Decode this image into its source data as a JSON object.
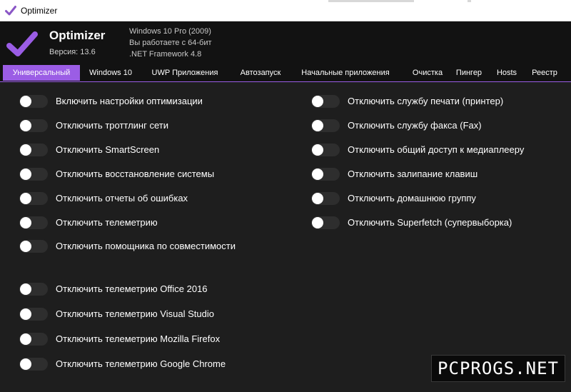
{
  "window": {
    "title": "Optimizer"
  },
  "header": {
    "app_name": "Optimizer",
    "version": "Версия: 13.6",
    "sysinfo": [
      "Windows 10 Pro (2009)",
      "Вы работаете с 64-бит",
      ".NET Framework 4.8"
    ]
  },
  "tabs": [
    {
      "label": "Универсальный",
      "active": true
    },
    {
      "label": "Windows 10",
      "active": false
    },
    {
      "label": "UWP Приложения",
      "active": false
    },
    {
      "label": "Автозапуск",
      "active": false
    },
    {
      "label": "Начальные приложения",
      "active": false
    },
    {
      "label": "Очистка",
      "active": false
    },
    {
      "label": "Пингер",
      "active": false
    },
    {
      "label": "Hosts",
      "active": false
    },
    {
      "label": "Реестр",
      "active": false
    }
  ],
  "left_options": [
    {
      "label": "Включить настройки оптимизации",
      "on": false
    },
    {
      "label": "Отключить троттлинг сети",
      "on": false
    },
    {
      "label": "Отключить SmartScreen",
      "on": false
    },
    {
      "label": "Отключить восстановление системы",
      "on": false
    },
    {
      "label": "Отключить отчеты об ошибках",
      "on": false
    },
    {
      "label": "Отключить телеметрию",
      "on": false
    },
    {
      "label": "Отключить помощника по совместимости",
      "on": false
    }
  ],
  "right_options": [
    {
      "label": "Отключить службу печати (принтер)",
      "on": false
    },
    {
      "label": "Отключить службу факса (Fax)",
      "on": false
    },
    {
      "label": "Отключить общий доступ к медиаплееру",
      "on": false
    },
    {
      "label": "Отключить залипание клавиш",
      "on": false
    },
    {
      "label": "Отключить домашнюю группу",
      "on": false
    },
    {
      "label": "Отключить Superfetch (супервыборка)",
      "on": false
    }
  ],
  "telemetry_options": [
    {
      "label": "Отключить телеметрию Office 2016",
      "on": false
    },
    {
      "label": "Отключить телеметрию Visual Studio",
      "on": false
    },
    {
      "label": "Отключить телеметрию Mozilla Firefox",
      "on": false
    },
    {
      "label": "Отключить телеметрию Google Chrome",
      "on": false
    }
  ],
  "watermark": "PCPROGS.NET",
  "colors": {
    "accent": "#9b5de5",
    "background": "#1e1e1e",
    "header_bg": "#121212",
    "toggle_off": "#2e2e2e",
    "text": "#ffffff"
  },
  "icons": {
    "app": "check-mark-icon"
  }
}
